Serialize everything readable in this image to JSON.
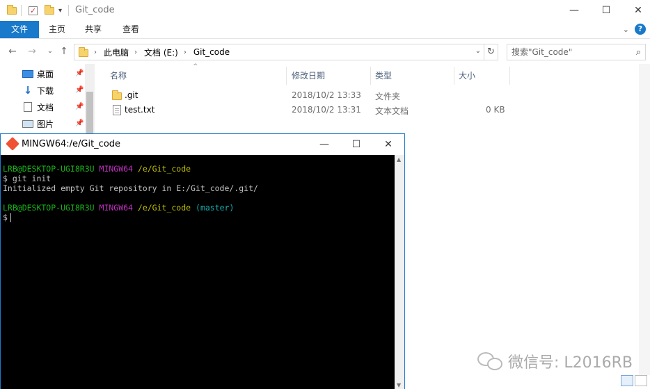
{
  "explorer": {
    "title": "Git_code",
    "window_buttons": {
      "minimize": "—",
      "maximize": "☐",
      "close": "✕"
    },
    "ribbon": {
      "tabs": [
        "文件",
        "主页",
        "共享",
        "查看"
      ],
      "collapse_glyph": "⌄",
      "help_glyph": "?"
    },
    "address": {
      "crumbs": [
        "此电脑",
        "文档 (E:)",
        "Git_code"
      ],
      "search_placeholder": "搜索\"Git_code\""
    },
    "nav_glyphs": {
      "back": "←",
      "forward": "→",
      "dropdown": "⌄",
      "up": "↑",
      "refresh": "↻",
      "search": "⌕"
    },
    "sidebar": {
      "items": [
        {
          "label": "桌面",
          "icon": "desktop-icon"
        },
        {
          "label": "下载",
          "icon": "download-icon"
        },
        {
          "label": "文档",
          "icon": "document-icon"
        },
        {
          "label": "图片",
          "icon": "picture-icon"
        }
      ],
      "pin_glyph": "📌"
    },
    "columns": [
      "名称",
      "修改日期",
      "类型",
      "大小"
    ],
    "files": [
      {
        "name": ".git",
        "modified": "2018/10/2 13:33",
        "type": "文件夹",
        "size": "",
        "icon": "folder-icon"
      },
      {
        "name": "test.txt",
        "modified": "2018/10/2 13:31",
        "type": "文本文档",
        "size": "0 KB",
        "icon": "text-file-icon"
      }
    ]
  },
  "terminal": {
    "title": "MINGW64:/e/Git_code",
    "prompt1": {
      "user": "LRB@DESKTOP-UGI8R3U",
      "env": "MINGW64",
      "path": "/e/Git_code",
      "branch": ""
    },
    "command1": "$ git init",
    "output1": "Initialized empty Git repository in E:/Git_code/.git/",
    "prompt2": {
      "user": "LRB@DESKTOP-UGI8R3U",
      "env": "MINGW64",
      "path": "/e/Git_code",
      "branch": "(master)"
    },
    "command2": "$",
    "window_buttons": {
      "minimize": "—",
      "maximize": "☐",
      "close": "✕"
    }
  },
  "watermark": {
    "text": "微信号: L2016RB"
  },
  "colors": {
    "accent": "#1979ca",
    "term_green": "#18b218",
    "term_magenta": "#c030c0",
    "term_yellow": "#c0c000",
    "term_cyan": "#18b2b2"
  }
}
